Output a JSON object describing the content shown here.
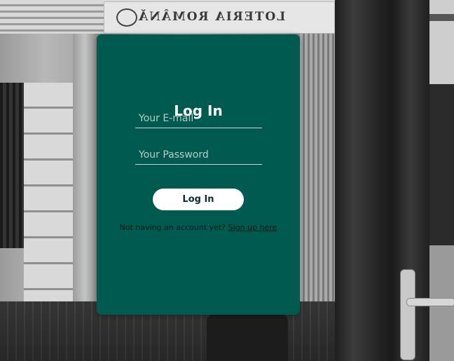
{
  "background": {
    "sign_text": "LOTERIA ROMÂNĂ"
  },
  "login_card": {
    "title": "Log In",
    "email": {
      "value": "",
      "placeholder": "Your E-mail"
    },
    "password": {
      "value": "",
      "placeholder": "Your Password"
    },
    "submit_label": "Log In",
    "signup_prompt": "Not having an account yet?",
    "signup_link": "Sign up here"
  },
  "colors": {
    "card_background": "#015a50",
    "button_background": "#ffffff",
    "title_text": "#ffffff"
  }
}
